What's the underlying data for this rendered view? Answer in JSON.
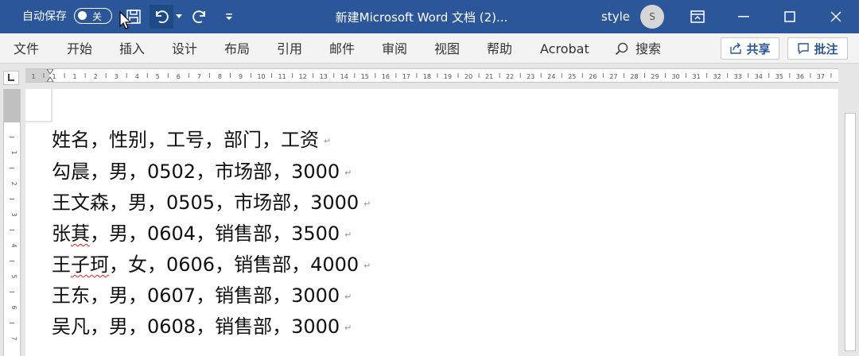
{
  "titlebar": {
    "autosave_label": "自动保存",
    "autosave_state": "关",
    "document_title": "新建Microsoft Word 文档 (2)...",
    "user_name": "style",
    "avatar_initial": "S"
  },
  "ribbon": {
    "tabs": [
      "文件",
      "开始",
      "插入",
      "设计",
      "布局",
      "引用",
      "邮件",
      "审阅",
      "视图",
      "帮助",
      "Acrobat"
    ],
    "search_label": "搜索",
    "share_label": "共享",
    "comment_label": "批注"
  },
  "document": {
    "lines": [
      "姓名，性别，工号，部门，工资",
      "勾晨，男，0502，市场部，3000",
      "王文森，男，0505，市场部，3000",
      "张萁，男，0604，销售部，3500",
      "王子珂，女，0606，销售部，4000",
      "王东，男，0607，销售部，3000",
      "吴凡，男，0608，销售部，3000"
    ],
    "line4_parts": [
      "张",
      "萁",
      "，男，0604，销售部，3500"
    ],
    "line5_parts": [
      "王",
      "子珂",
      "，女，0606，销售部，4000"
    ],
    "paragraph_mark": "↵"
  },
  "ruler": {
    "numbers": [
      "1",
      "1",
      "1",
      "2",
      "3",
      "4",
      "5",
      "6",
      "7",
      "8",
      "9",
      "10",
      "11",
      "12",
      "13",
      "14",
      "15",
      "16",
      "17",
      "18",
      "19",
      "20",
      "21",
      "22",
      "23",
      "24",
      "25",
      "26",
      "27",
      "28",
      "29",
      "30",
      "31",
      "32",
      "33",
      "34",
      "35",
      "36",
      "37"
    ],
    "vnumbers": [
      "1",
      "2",
      "3",
      "4",
      "5",
      "6",
      "7"
    ]
  }
}
